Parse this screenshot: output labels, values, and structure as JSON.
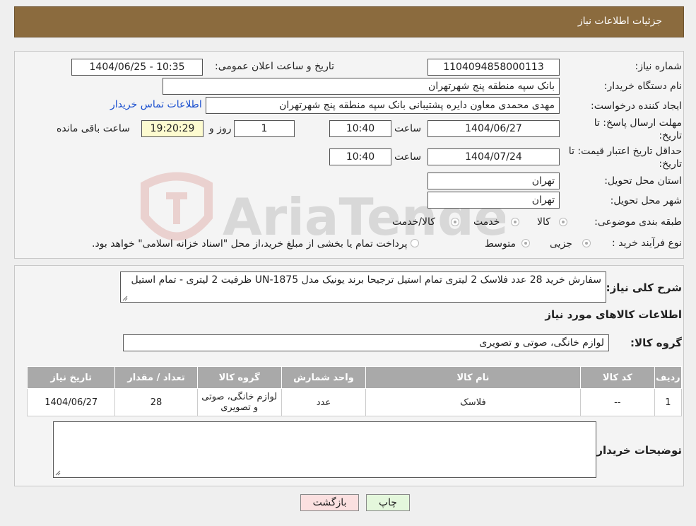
{
  "header": {
    "title": "جزئیات اطلاعات نیاز"
  },
  "form": {
    "need_number_label": "شماره نیاز:",
    "need_number": "1104094858000113",
    "announce_label": "تاریخ و ساعت اعلان عمومی:",
    "announce_value": "1404/06/25 - 10:35",
    "buyer_org_label": "نام دستگاه خریدار:",
    "buyer_org": "بانک سپه منطقه پنج شهرتهران",
    "creator_label": "ایجاد کننده درخواست:",
    "creator": "مهدی محمدی معاون دایره پشتیبانی بانک سپه منطقه پنج شهرتهران",
    "contact_link": "اطلاعات تماس خریدار",
    "deadline_label_1": "مهلت ارسال پاسخ: تا",
    "deadline_label_2": "تاریخ:",
    "deadline_date": "1404/06/27",
    "time_label": "ساعت",
    "deadline_time": "10:40",
    "days": "1",
    "days_label": "روز و",
    "remaining": "19:20:29",
    "remaining_label": "ساعت باقی مانده",
    "validity_label_1": "حداقل تاریخ اعتبار قیمت: تا",
    "validity_label_2": "تاریخ:",
    "validity_date": "1404/07/24",
    "validity_time": "10:40",
    "province_label": "استان محل تحویل:",
    "province": "تهران",
    "city_label": "شهر محل تحویل:",
    "city": "تهران",
    "category_label": "طبقه بندی موضوعی:",
    "category_options": [
      "کالا",
      "خدمت",
      "کالا/خدمت"
    ],
    "process_label": "نوع فرآیند خرید :",
    "process_options": [
      "جزیی",
      "متوسط"
    ],
    "process_note": "پرداخت تمام یا بخشی از مبلغ خرید،از محل \"اسناد خزانه اسلامی\" خواهد بود."
  },
  "description": {
    "label": "شرح کلی نیاز:",
    "text": "سفارش خرید 28 عدد فلاسک  2 لیتری تمام استیل  ترجیحا برند یونیک مدل UN-1875  ظرفیت 2 لیتری - تمام استیل"
  },
  "goods": {
    "section_title": "اطلاعات کالاهای مورد نیاز",
    "group_label": "گروه کالا:",
    "group_value": "لوازم خانگی، صوتی و تصویری",
    "columns": [
      "ردیف",
      "کد کالا",
      "نام کالا",
      "واحد شمارش",
      "گروه کالا",
      "تعداد / مقدار",
      "تاریخ نیاز"
    ],
    "rows": [
      [
        "1",
        "--",
        "فلاسک",
        "عدد",
        "لوازم خانگی، صوتی و تصویری",
        "28",
        "1404/06/27"
      ]
    ]
  },
  "buyer_notes": {
    "label": "توضیحات خریدار:",
    "text": ""
  },
  "buttons": {
    "print": "چاپ",
    "back": "بازگشت"
  },
  "watermark": {
    "text": "AriaTender.neT"
  },
  "colors": {
    "header": "#8b6b3e",
    "link": "#1a4fcf",
    "back_button": "#fbe0e0",
    "print_button": "#e4f7dc"
  }
}
